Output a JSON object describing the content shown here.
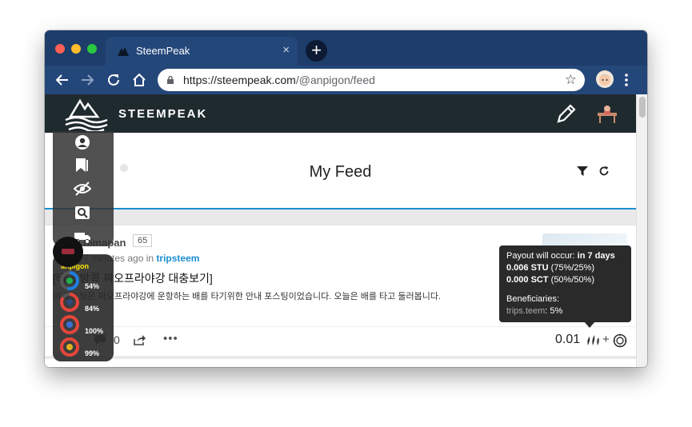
{
  "browser": {
    "tab_title": "SteemPeak",
    "tab_close": "×",
    "new_tab": "+",
    "url_host": "https://steempeak.com",
    "url_path": "/@anpigon/feed",
    "star": "☆"
  },
  "site": {
    "brand": "STEEMPEAK",
    "feed_title": "My Feed"
  },
  "post": {
    "author": "nimapan",
    "reputation": "65",
    "time_ago": "7 minutes ago in",
    "category": "tripsteem",
    "title": "[태국 방콕 짜오프라야강 대충보기]",
    "excerpt": "이 포스팅은 짜오프라야강에 운항하는 배를 타기위한 안내 포스팅이었습니다. 오늘은 배를 타고 둘러봅니다.",
    "comments": "0",
    "more": "•••",
    "payout_value": "0.01",
    "plus": "+"
  },
  "tooltip": {
    "payout_label": "Payout will occur:",
    "payout_when": "in 7 days",
    "stu_value": "0.006 STU",
    "stu_split": "(75%/25%)",
    "sct_value": "0.000 SCT",
    "sct_split": "(50%/50%)",
    "beneficiaries_label": "Beneficiaries:",
    "beneficiary_name": "trips.teem",
    "beneficiary_pct": ": 5%"
  },
  "overlay": {
    "username": "anpigon",
    "gauges": [
      {
        "label": "54%",
        "value": 54,
        "color": "#1f7fe0"
      },
      {
        "label": "84%",
        "value": 84,
        "color": "#e6453a"
      },
      {
        "label": "100%",
        "value": 100,
        "color": "#e6453a"
      },
      {
        "label": "99%",
        "value": 99,
        "color": "#e6453a"
      }
    ]
  }
}
